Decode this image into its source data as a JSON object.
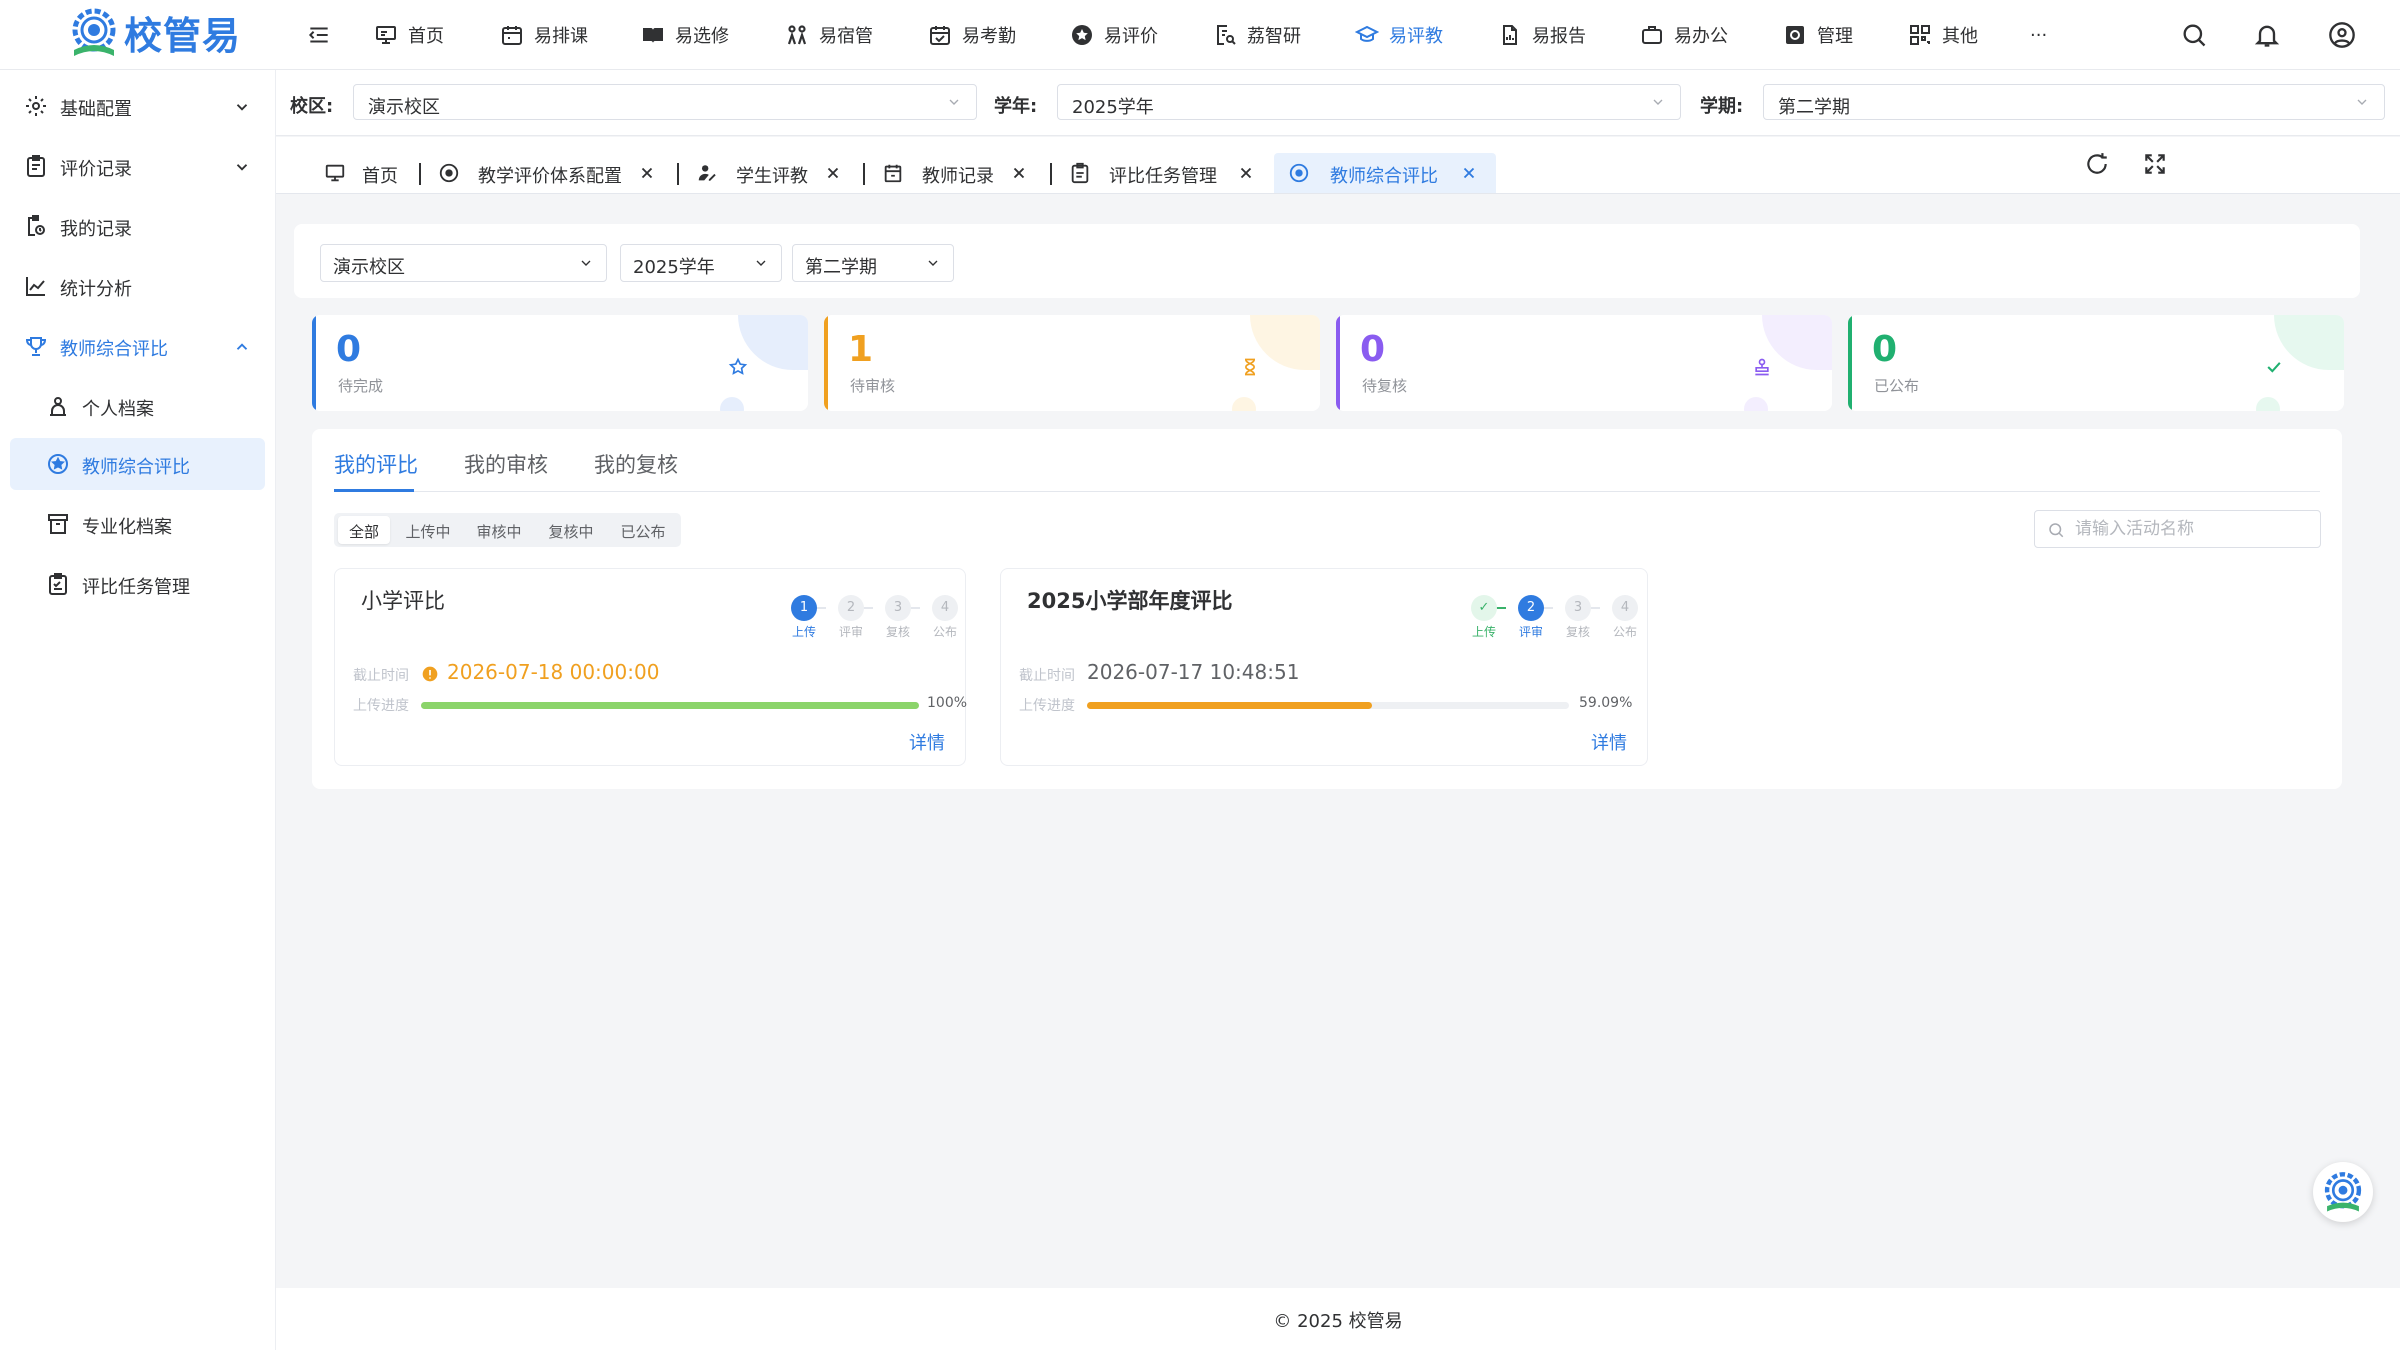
{
  "app": {
    "logo_text": "校管易"
  },
  "topnav": [
    {
      "label": "首页",
      "icon": "monitor-icon"
    },
    {
      "label": "易排课",
      "icon": "calendar-icon"
    },
    {
      "label": "易选修",
      "icon": "book-icon"
    },
    {
      "label": "易宿管",
      "icon": "bunkbed-icon"
    },
    {
      "label": "易考勤",
      "icon": "calendar-check-icon"
    },
    {
      "label": "易评价",
      "icon": "star-badge-icon"
    },
    {
      "label": "荔智研",
      "icon": "research-icon"
    },
    {
      "label": "易评教",
      "icon": "graduation-cap-icon",
      "active": true
    },
    {
      "label": "易报告",
      "icon": "report-icon"
    },
    {
      "label": "易办公",
      "icon": "briefcase-icon"
    },
    {
      "label": "管理",
      "icon": "manage-icon"
    },
    {
      "label": "其他",
      "icon": "grid-icon"
    }
  ],
  "topnav_more": "···",
  "sidebar": [
    {
      "label": "基础配置",
      "icon": "gear-icon",
      "chevron": "down"
    },
    {
      "label": "评价记录",
      "icon": "clipboard-icon",
      "chevron": "down"
    },
    {
      "label": "我的记录",
      "icon": "record-icon"
    },
    {
      "label": "统计分析",
      "icon": "chart-line-icon"
    },
    {
      "label": "教师综合评比",
      "icon": "trophy-icon",
      "chevron": "up",
      "state": "open"
    },
    {
      "label": "个人档案",
      "icon": "person-icon",
      "sub": true
    },
    {
      "label": "教师综合评比",
      "icon": "star-circle-icon",
      "sub": true,
      "active": true
    },
    {
      "label": "专业化档案",
      "icon": "archive-icon",
      "sub": true
    },
    {
      "label": "评比任务管理",
      "icon": "task-icon",
      "sub": true
    }
  ],
  "filter": {
    "campus_label": "校区:",
    "campus_value": "演示校区",
    "year_label": "学年:",
    "year_value": "2025学年",
    "term_label": "学期:",
    "term_value": "第二学期"
  },
  "tabs": [
    {
      "label": "首页"
    },
    {
      "label": "教学评价体系配置"
    },
    {
      "label": "学生评教"
    },
    {
      "label": "教师记录"
    },
    {
      "label": "评比任务管理"
    },
    {
      "label": "教师综合评比",
      "active": true
    }
  ],
  "content_filters": {
    "campus": "演示校区",
    "year": "2025学年",
    "term": "第二学期"
  },
  "stats": [
    {
      "value": "0",
      "label": "待完成",
      "color": "#2f7be0",
      "icon": "star-outline-icon"
    },
    {
      "value": "1",
      "label": "待审核",
      "color": "#f0a020",
      "icon": "hourglass-icon"
    },
    {
      "value": "0",
      "label": "待复核",
      "color": "#8a5cf0",
      "icon": "stamp-icon"
    },
    {
      "value": "0",
      "label": "已公布",
      "color": "#20b070",
      "icon": "check-icon"
    }
  ],
  "content_tabs": [
    {
      "label": "我的评比",
      "active": true
    },
    {
      "label": "我的审核"
    },
    {
      "label": "我的复核"
    }
  ],
  "status_filters": [
    {
      "label": "全部",
      "active": true
    },
    {
      "label": "上传中"
    },
    {
      "label": "审核中"
    },
    {
      "label": "复核中"
    },
    {
      "label": "已公布"
    }
  ],
  "search": {
    "placeholder": "请输入活动名称",
    "value": ""
  },
  "cards": [
    {
      "title": "小学评比",
      "bold": false,
      "current_step": 1,
      "steps": [
        {
          "num": "1",
          "label": "上传"
        },
        {
          "num": "2",
          "label": "评审"
        },
        {
          "num": "3",
          "label": "复核"
        },
        {
          "num": "4",
          "label": "公布"
        }
      ],
      "deadline_label": "截止时间",
      "deadline": "2026-07-18 00:00:00",
      "deadline_warning": true,
      "progress_label": "上传进度",
      "progress": 100,
      "progress_text": "100%",
      "progress_color": "#8bd46a",
      "detail": "详情"
    },
    {
      "title": "2025小学部年度评比",
      "bold": true,
      "current_step": 2,
      "steps": [
        {
          "num": "✓",
          "label": "上传"
        },
        {
          "num": "2",
          "label": "评审"
        },
        {
          "num": "3",
          "label": "复核"
        },
        {
          "num": "4",
          "label": "公布"
        }
      ],
      "deadline_label": "截止时间",
      "deadline": "2026-07-17 10:48:51",
      "deadline_warning": false,
      "progress_label": "上传进度",
      "progress": 59.09,
      "progress_text": "59.09%",
      "progress_color": "#f0a020",
      "detail": "详情"
    }
  ],
  "footer": "© 2025 校管易"
}
